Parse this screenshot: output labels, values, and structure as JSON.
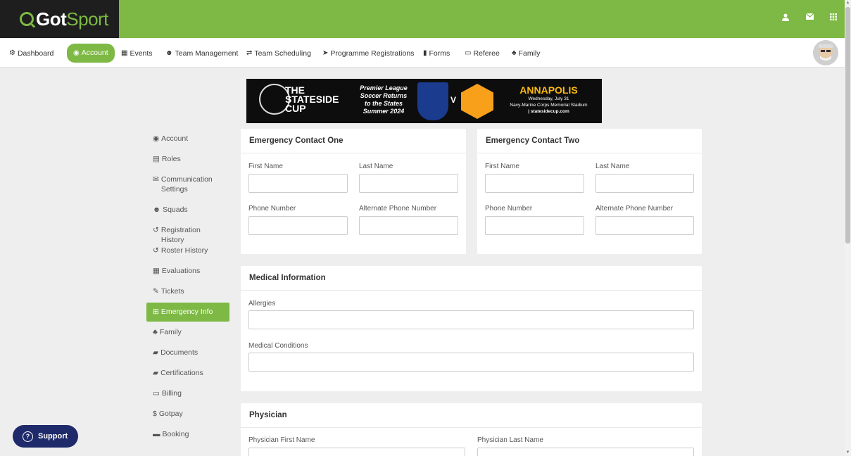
{
  "brand": {
    "got": "Got",
    "sport": "Sport"
  },
  "topbar": {
    "icons": [
      "user-icon",
      "mail-icon",
      "grid-icon"
    ]
  },
  "nav": {
    "items": [
      {
        "label": "Dashboard",
        "icon": "dashboard-icon"
      },
      {
        "label": "Account",
        "icon": "user-circle-icon"
      },
      {
        "label": "Events",
        "icon": "calendar-icon"
      },
      {
        "label": "Team Management",
        "icon": "users-icon"
      },
      {
        "label": "Team Scheduling",
        "icon": "exchange-icon"
      },
      {
        "label": "Programme Registrations",
        "icon": "paper-plane-icon"
      },
      {
        "label": "Forms",
        "icon": "file-icon"
      },
      {
        "label": "Referee",
        "icon": "calendar-icon"
      },
      {
        "label": "Family",
        "icon": "sitemap-icon"
      }
    ]
  },
  "banner": {
    "title_line1": "THE",
    "title_line2": "STATESIDE",
    "title_line3": "CUP",
    "tagline_1": "Premier League",
    "tagline_2": "Soccer Returns",
    "tagline_3": "to the States",
    "tagline_4": "Summer 2024",
    "versus": "V",
    "city": "ANNAPOLIS",
    "date": "Wednesday, July 31",
    "venue": "Navy-Marine Corps Memorial Stadium",
    "site": "| statesidecup.com"
  },
  "sidemenu": {
    "items": [
      {
        "label": "Account",
        "icon": "user-circle-icon"
      },
      {
        "label": "Roles",
        "icon": "id-card-icon"
      },
      {
        "label": "Communication Settings",
        "icon": "envelope-icon"
      },
      {
        "label": "Squads",
        "icon": "users-icon"
      },
      {
        "label": "Registration History",
        "icon": "history-icon"
      },
      {
        "label": "Roster History",
        "icon": "history-icon"
      },
      {
        "label": "Evaluations",
        "icon": "calendar-check-icon"
      },
      {
        "label": "Tickets",
        "icon": "ticket-icon"
      },
      {
        "label": "Emergency Info",
        "icon": "plus-square-icon"
      },
      {
        "label": "Family",
        "icon": "sitemap-icon"
      },
      {
        "label": "Documents",
        "icon": "folder-icon"
      },
      {
        "label": "Certifications",
        "icon": "folder-icon"
      },
      {
        "label": "Billing",
        "icon": "credit-card-icon"
      },
      {
        "label": "Gotpay",
        "icon": "dollar-icon"
      },
      {
        "label": "Booking",
        "icon": "bed-icon"
      }
    ]
  },
  "contact_one": {
    "title": "Emergency Contact One",
    "first_name": "First Name",
    "last_name": "Last Name",
    "phone": "Phone Number",
    "alt_phone": "Alternate Phone Number"
  },
  "contact_two": {
    "title": "Emergency Contact Two",
    "first_name": "First Name",
    "last_name": "Last Name",
    "phone": "Phone Number",
    "alt_phone": "Alternate Phone Number"
  },
  "medical": {
    "title": "Medical Information",
    "allergies": "Allergies",
    "conditions": "Medical Conditions"
  },
  "physician": {
    "title": "Physician",
    "first_name": "Physician First Name",
    "last_name": "Physician Last Name"
  },
  "support": {
    "label": "Support"
  },
  "colors": {
    "brand_green": "#7db944",
    "support_navy": "#1f2a6b",
    "logo_bg": "#1e1e1e"
  }
}
